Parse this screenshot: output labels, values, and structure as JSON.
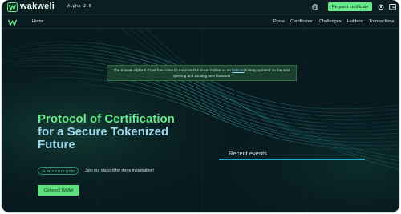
{
  "topbar": {
    "brand": "wakweli",
    "version": "Alpha 2.0",
    "request_certificate": "Request certificate"
  },
  "navbar": {
    "home": "Home",
    "items": [
      "Pools",
      "Certificates",
      "Challenges",
      "Holders",
      "Transactions"
    ]
  },
  "notice": {
    "text_before": "The 8-week Alpha 2.0 test has come to a successful close. Follow us on ",
    "link": "Discord",
    "text_after": " to stay updated on the next opening and exciting new features!"
  },
  "hero": {
    "title_accent": "Protocol of Certification",
    "title_mid": "for a Secure Tokenized",
    "title_end": "Future",
    "live_badge": "ALPHA 2.0 IS LIVE!",
    "discord_note": "Join our discord for more information!",
    "connect_wallet": "Connect Wallet"
  },
  "events": {
    "title": "Recent events"
  },
  "colors": {
    "accent_green": "#67e98c",
    "accent_blue": "#9ed8ef",
    "background": "#071a1f",
    "events_line": "#2fa6c0"
  },
  "icons": [
    "wakweli-logo-icon",
    "globe-icon",
    "gear-icon",
    "wallet-icon"
  ]
}
